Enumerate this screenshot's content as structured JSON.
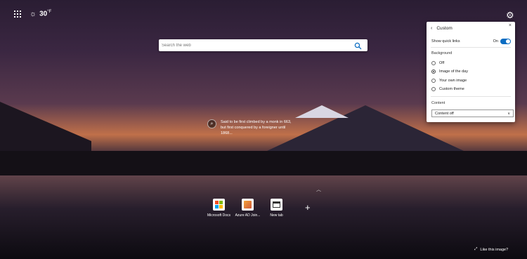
{
  "topbar": {
    "apps_icon": "apps-grid-icon",
    "weather_icon": "sun-icon",
    "temperature": "30",
    "unit": "°F"
  },
  "search": {
    "placeholder": "Search the web",
    "icon": "search-icon"
  },
  "image_caption": {
    "text": "Said to be first climbed by a monk in 663, but first conquered by a foreigner until 1868..."
  },
  "quick_links": [
    {
      "label": "Microsoft Docs",
      "icon": "microsoft-logo-icon"
    },
    {
      "label": "Azure AD Join...",
      "icon": "azure-icon"
    },
    {
      "label": "New tab",
      "icon": "new-tab-icon"
    }
  ],
  "add_link_glyph": "+",
  "like_image": {
    "label": "Like this image?",
    "icon": "expand-icon"
  },
  "panel": {
    "title": "Custom",
    "show_quick_links_label": "Show quick links",
    "show_quick_links_state": "On",
    "background_label": "Background",
    "background_options": [
      {
        "label": "Off",
        "checked": false
      },
      {
        "label": "Image of the day",
        "checked": true
      },
      {
        "label": "Your own image",
        "checked": false
      },
      {
        "label": "Custom theme",
        "checked": false
      }
    ],
    "content_label": "Content",
    "content_value": "Content off"
  },
  "colors": {
    "accent": "#0a6cc2",
    "ms_red": "#f25022",
    "ms_green": "#7fba00",
    "ms_blue": "#00a4ef",
    "ms_yellow": "#ffb900"
  }
}
